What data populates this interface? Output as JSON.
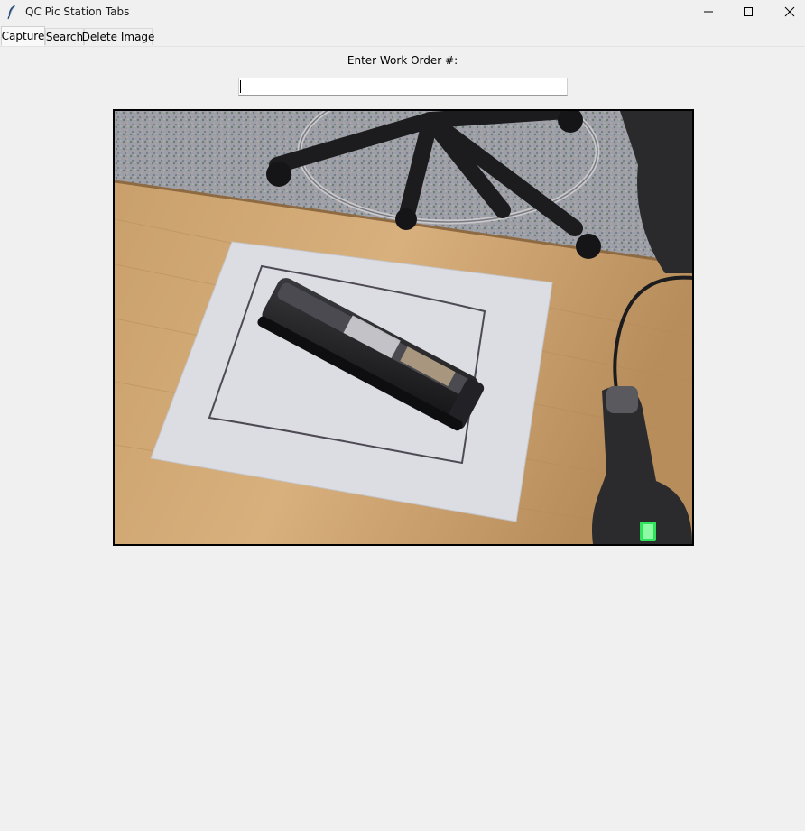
{
  "window": {
    "title": "QC Pic Station Tabs"
  },
  "tabs": [
    {
      "label": "Capture",
      "active": true
    },
    {
      "label": "Search",
      "active": false
    },
    {
      "label": "Delete Image",
      "active": false
    }
  ],
  "capture": {
    "prompt_label": "Enter Work Order #:",
    "work_order_value": ""
  },
  "icons": {
    "app": "feather-icon",
    "minimize": "minimize-icon",
    "maximize": "maximize-icon",
    "close": "close-icon"
  },
  "colors": {
    "window_bg": "#f0f0f0",
    "frame_border": "#000000",
    "input_bg": "#ffffff"
  }
}
